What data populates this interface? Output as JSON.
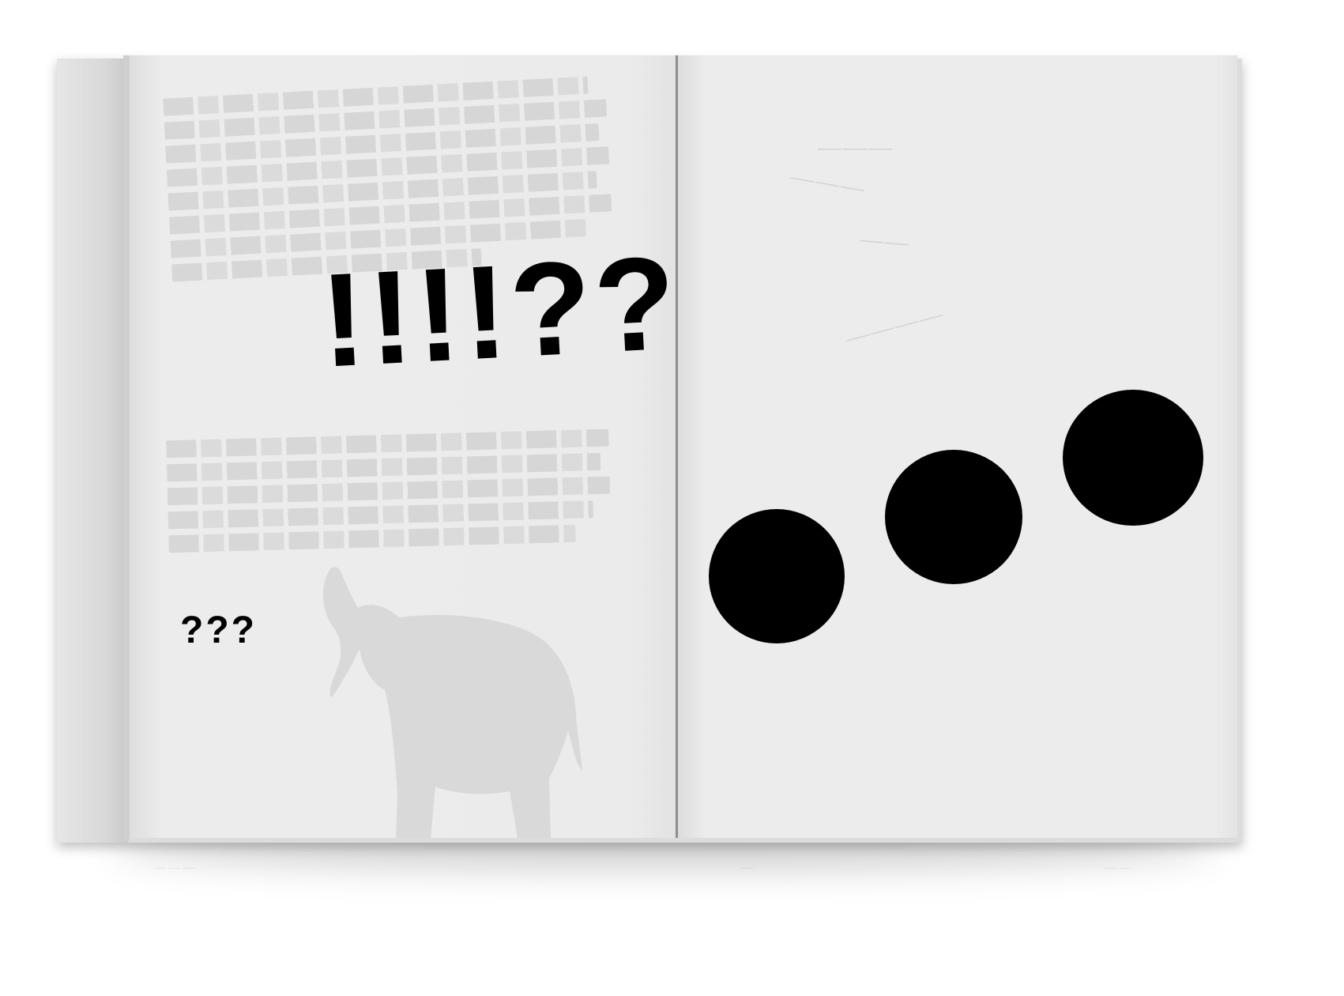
{
  "photo": {
    "subject": "open-book-spread",
    "left_page": {
      "headline": "!!!!??",
      "small_mark": "???"
    },
    "right_page": {
      "ellipsis_dot_count": 3
    }
  },
  "colors": {
    "background": "#ffffff",
    "paper": "#ebebeb",
    "ink": "#000000",
    "ghost": "#d6d6d6"
  },
  "icons": [
    "elephant-silhouette"
  ]
}
